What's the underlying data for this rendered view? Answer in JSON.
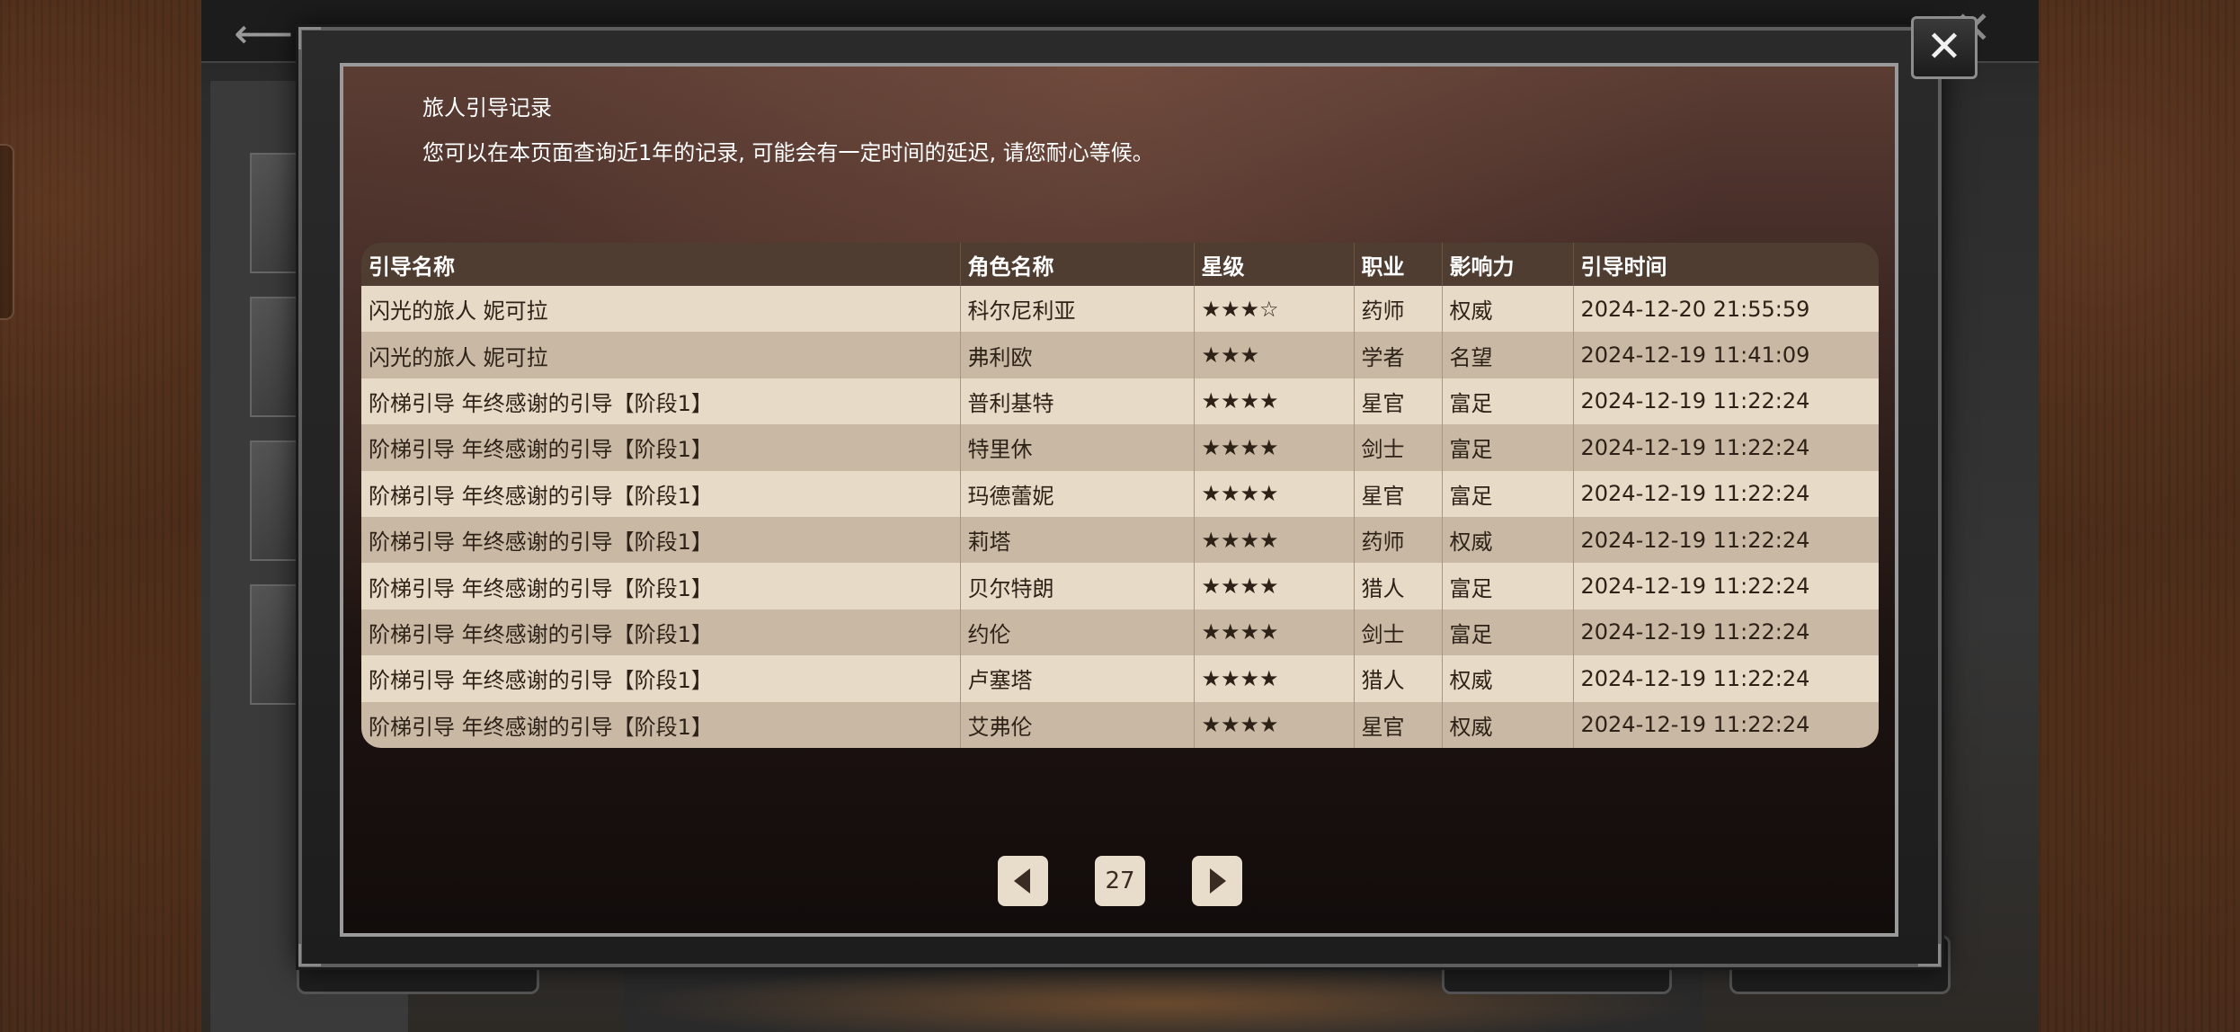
{
  "dialog": {
    "title": "旅人引导记录",
    "subtitle": "您可以在本页面查询近1年的记录, 可能会有一定时间的延迟, 请您耐心等候。",
    "close_icon": "✕"
  },
  "table": {
    "headers": [
      "引导名称",
      "角色名称",
      "星级",
      "职业",
      "影响力",
      "引导时间"
    ],
    "rows": [
      [
        "闪光的旅人 妮可拉",
        "科尔尼利亚",
        "★★★☆",
        "药师",
        "权威",
        "2024-12-20 21:55:59"
      ],
      [
        "闪光的旅人 妮可拉",
        "弗利欧",
        "★★★",
        "学者",
        "名望",
        "2024-12-19 11:41:09"
      ],
      [
        "阶梯引导 年终感谢的引导【阶段1】",
        "普利基特",
        "★★★★",
        "星官",
        "富足",
        "2024-12-19 11:22:24"
      ],
      [
        "阶梯引导 年终感谢的引导【阶段1】",
        "特里休",
        "★★★★",
        "剑士",
        "富足",
        "2024-12-19 11:22:24"
      ],
      [
        "阶梯引导 年终感谢的引导【阶段1】",
        "玛德蕾妮",
        "★★★★",
        "星官",
        "富足",
        "2024-12-19 11:22:24"
      ],
      [
        "阶梯引导 年终感谢的引导【阶段1】",
        "莉塔",
        "★★★★",
        "药师",
        "权威",
        "2024-12-19 11:22:24"
      ],
      [
        "阶梯引导 年终感谢的引导【阶段1】",
        "贝尔特朗",
        "★★★★",
        "猎人",
        "富足",
        "2024-12-19 11:22:24"
      ],
      [
        "阶梯引导 年终感谢的引导【阶段1】",
        "约伦",
        "★★★★",
        "剑士",
        "富足",
        "2024-12-19 11:22:24"
      ],
      [
        "阶梯引导 年终感谢的引导【阶段1】",
        "卢塞塔",
        "★★★★",
        "猎人",
        "权威",
        "2024-12-19 11:22:24"
      ],
      [
        "阶梯引导 年终感谢的引导【阶段1】",
        "艾弗伦",
        "★★★★",
        "星官",
        "权威",
        "2024-12-19 11:22:24"
      ]
    ]
  },
  "pagination": {
    "page": "27"
  },
  "icons": {
    "prev": "triangle-left-icon",
    "next": "triangle-right-icon",
    "close": "close-icon",
    "back": "back-arrow-icon"
  },
  "colors": {
    "header_bg": "#4f3d31",
    "row_light": "#e7dac6",
    "row_dark": "#c9b9a4",
    "button_bg": "#e8dccb"
  }
}
